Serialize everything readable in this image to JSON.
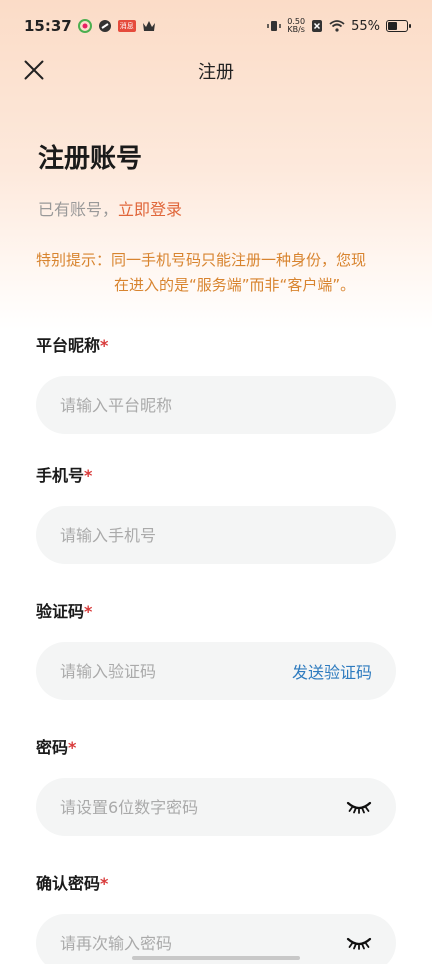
{
  "status": {
    "time": "15:37",
    "speed_top": "0.50",
    "speed_bottom": "KB/s",
    "battery_text": "55%",
    "battery_level": 0.55,
    "red_badge": "消息"
  },
  "nav": {
    "title": "注册"
  },
  "page": {
    "title": "注册账号",
    "have_account": "已有账号，",
    "login_link": "立即登录"
  },
  "notice": {
    "line1": "特别提示：同一手机号码只能注册一种身份，您现",
    "line2": "在进入的是“服务端”而非“客户端”。"
  },
  "fields": {
    "nickname": {
      "label": "平台昵称",
      "required": "*",
      "placeholder": "请输入平台昵称"
    },
    "phone": {
      "label": "手机号",
      "required": "*",
      "placeholder": "请输入手机号"
    },
    "code": {
      "label": "验证码",
      "required": "*",
      "placeholder": "请输入验证码",
      "send_label": "发送验证码"
    },
    "password": {
      "label": "密码",
      "required": "*",
      "placeholder": "请设置6位数字密码"
    },
    "confirm": {
      "label": "确认密码",
      "required": "*",
      "placeholder": "请再次输入密码"
    }
  },
  "colors": {
    "accent_orange": "#e0663a",
    "notice_orange": "#d8842f",
    "link_blue": "#2e7bbf",
    "required_red": "#d83a3a"
  }
}
